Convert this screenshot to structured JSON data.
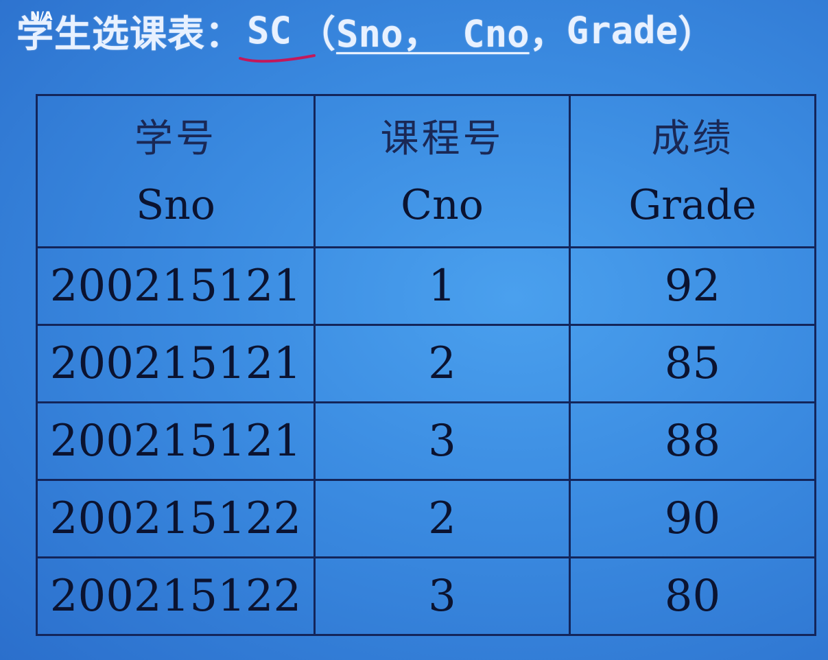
{
  "corner_label": "N/A",
  "heading": {
    "prefix": "学生选课表：",
    "table_name": "SC",
    "open_paren": "（",
    "key_fields": "Sno， Cno",
    "separator": "，",
    "other_field": "Grade",
    "close_paren": "）"
  },
  "table": {
    "headers": [
      {
        "zh": "学号",
        "en": "Sno"
      },
      {
        "zh": "课程号",
        "en": "Cno"
      },
      {
        "zh": "成绩",
        "en": "Grade"
      }
    ],
    "rows": [
      [
        "200215121",
        "1",
        "92"
      ],
      [
        "200215121",
        "2",
        "85"
      ],
      [
        "200215121",
        "3",
        "88"
      ],
      [
        "200215122",
        "2",
        "90"
      ],
      [
        "200215122",
        "3",
        "80"
      ]
    ]
  },
  "colors": {
    "background": "#3a8ae0",
    "grid_line": "#13255a",
    "heading_text": "#e8f1ff",
    "annotation_ink": "#c2185b"
  }
}
